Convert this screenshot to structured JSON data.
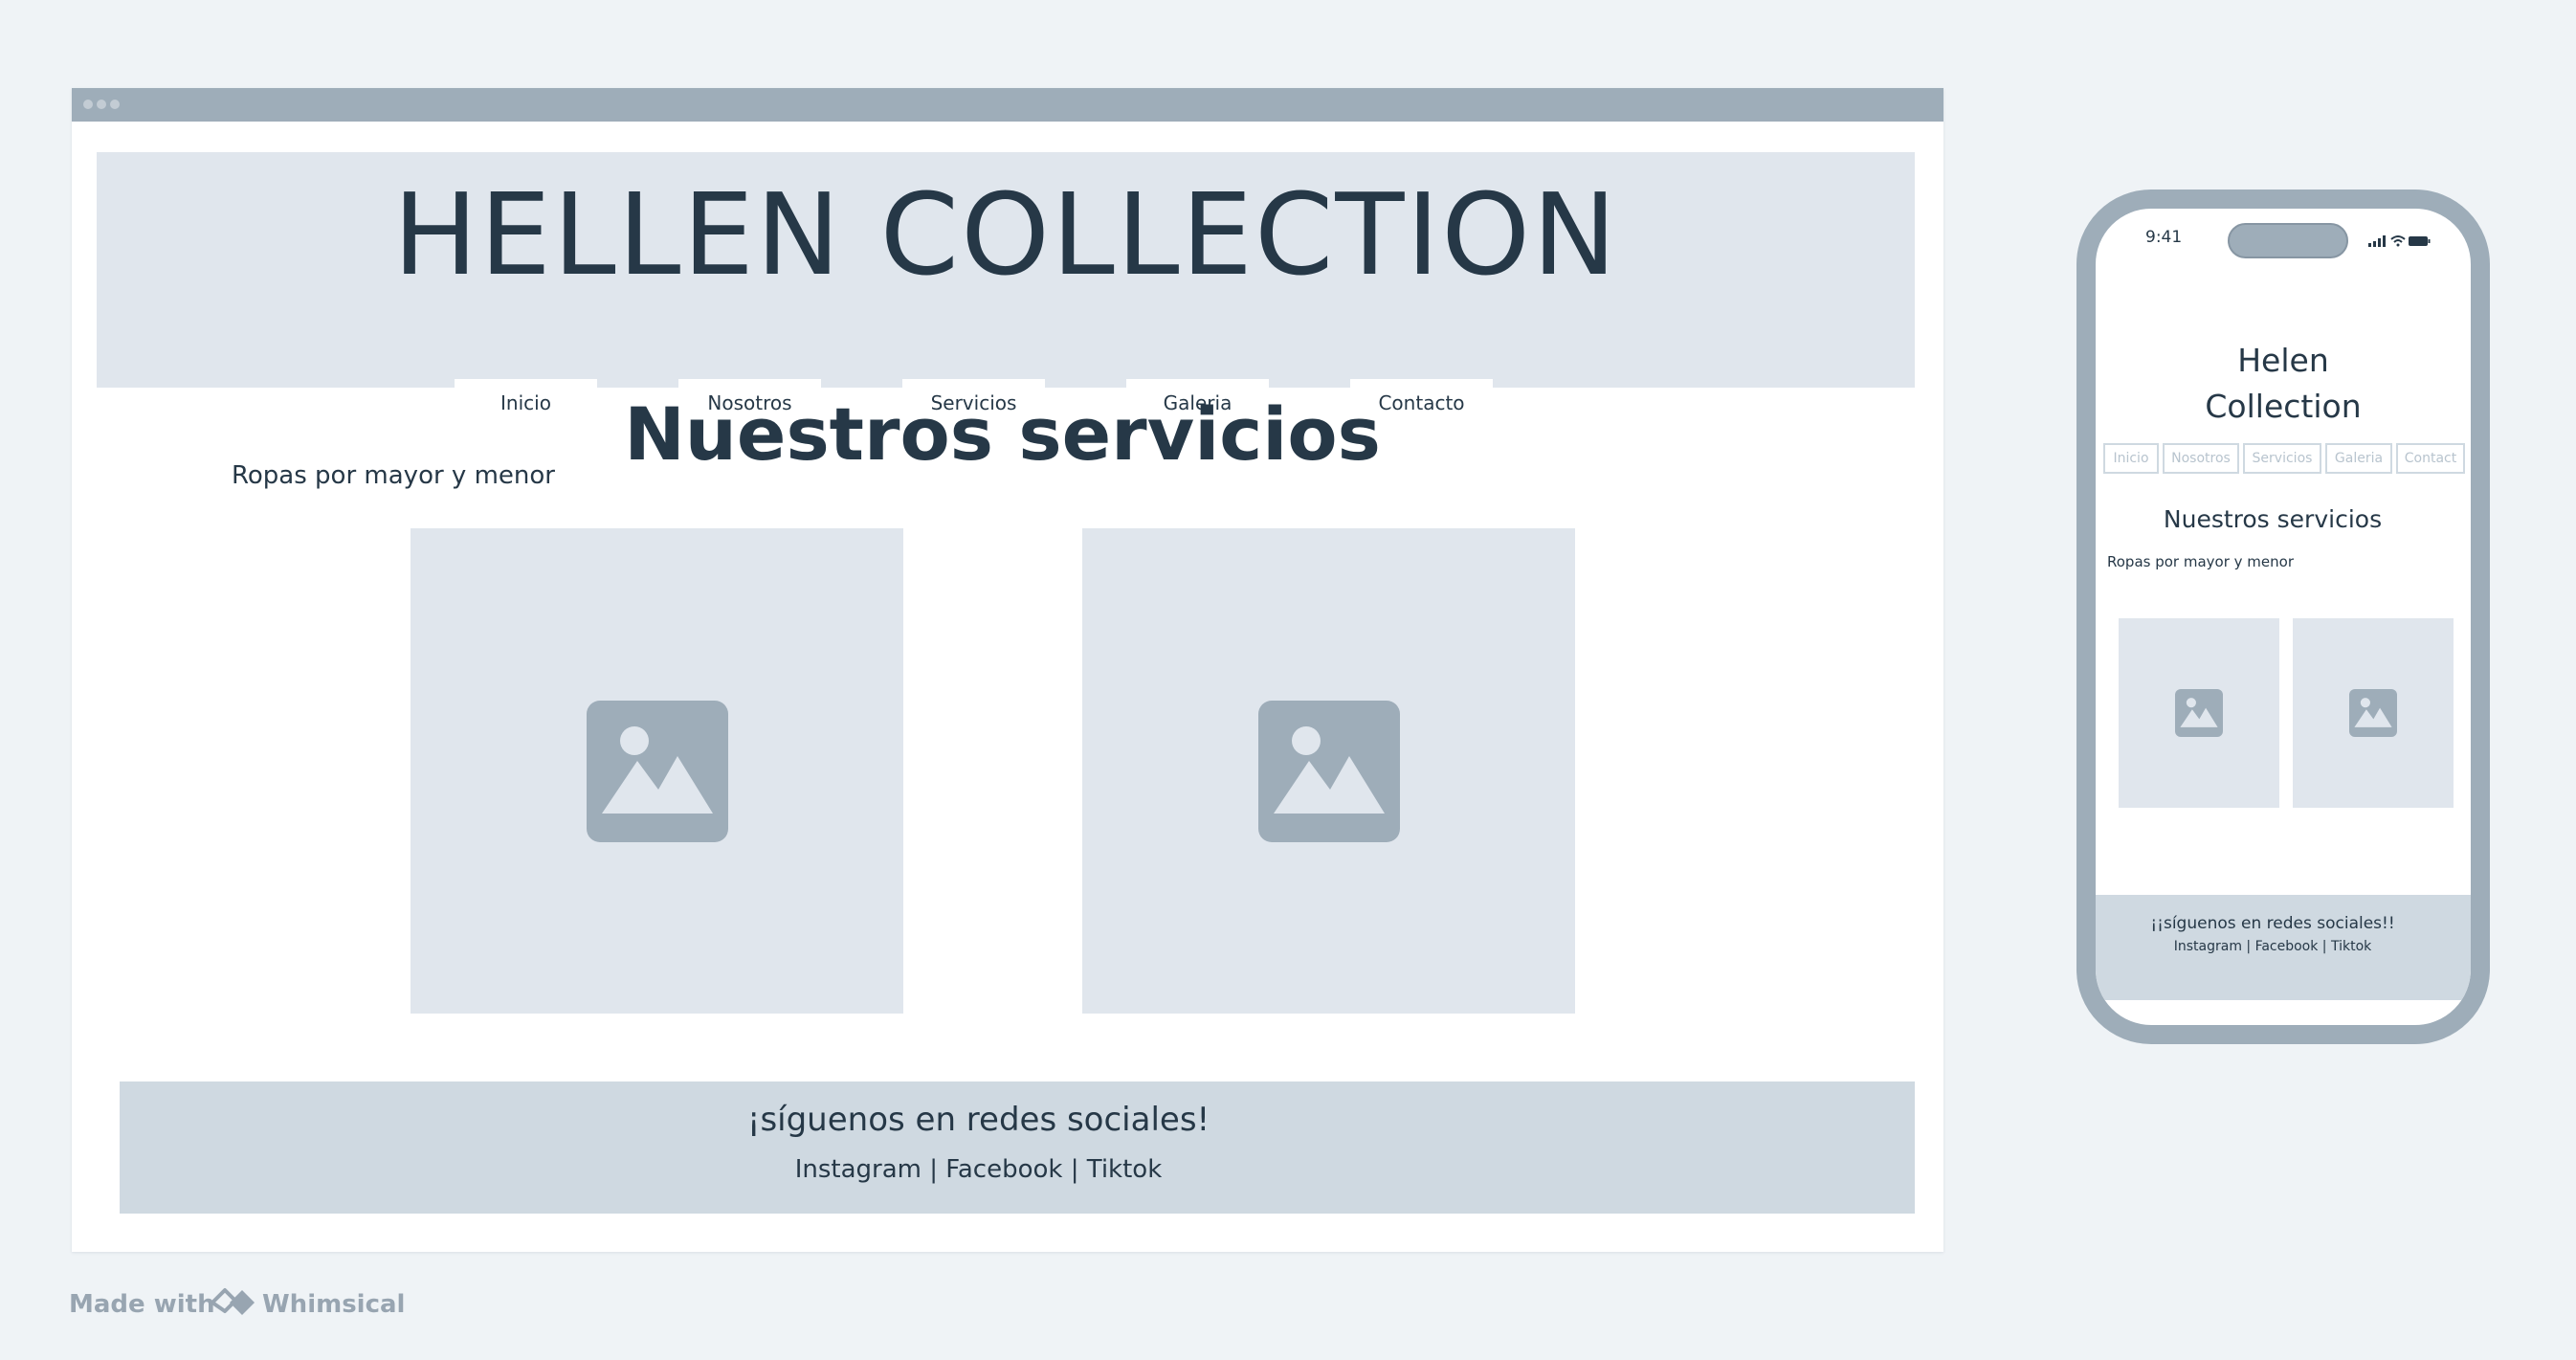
{
  "desktop": {
    "hero_title": "HELLEN COLLECTION",
    "nav": [
      "Inicio",
      "Nosotros",
      "Servicios",
      "Galeria",
      "Contacto"
    ],
    "services_title": "Nuestros servicios",
    "tagline": "Ropas por mayor y menor",
    "footer_title": "¡síguenos en redes sociales!",
    "footer_links": "Instagram | Facebook | Tiktok"
  },
  "mobile": {
    "status_time": "9:41",
    "title_line1": "Helen",
    "title_line2": "Collection",
    "nav": [
      "Inicio",
      "Nosotros",
      "Servicios",
      "Galeria",
      "Contact"
    ],
    "services_title": "Nuestros servicios",
    "tagline": "Ropas por mayor y menor",
    "footer_title": "¡¡síguenos en redes sociales!!",
    "footer_links": "Instagram | Facebook | Tiktok"
  },
  "watermark": {
    "made_with": "Made with",
    "brand": "Whimsical"
  },
  "icons": {
    "image_placeholder": "image-placeholder-icon",
    "signal": "signal-icon",
    "wifi": "wifi-icon",
    "battery": "battery-icon",
    "logo": "whimsical-logo-icon"
  },
  "colors": {
    "frame": "#9eadb9",
    "hero_bg": "#e0e6ed",
    "footer_bg": "#cfd9e1",
    "text": "#263847",
    "page_bg": "#eff3f6"
  }
}
